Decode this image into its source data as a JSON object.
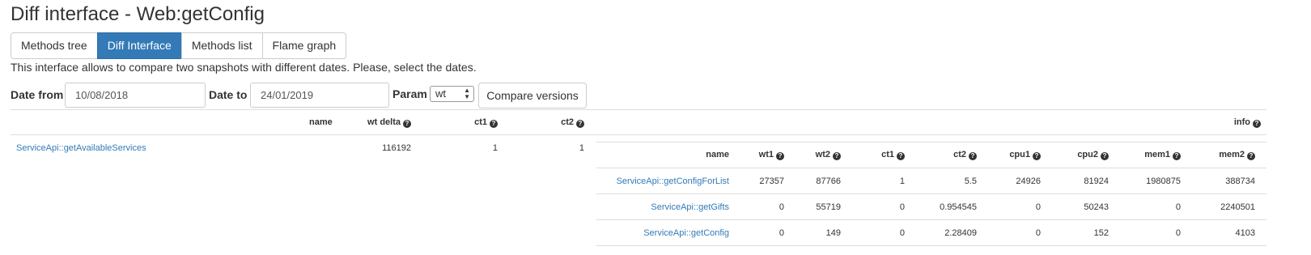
{
  "page": {
    "title": "Diff interface - Web:getConfig",
    "description": "This interface allows to compare two snapshots with different dates. Please, select the dates."
  },
  "tabs": [
    "Methods tree",
    "Diff Interface",
    "Methods list",
    "Flame graph"
  ],
  "active_tab": "Diff Interface",
  "form": {
    "date_from_label": "Date from",
    "date_from_value": "10/08/2018",
    "date_to_label": "Date to",
    "date_to_value": "24/01/2019",
    "param_label": "Param",
    "param_value": "wt",
    "compare_button": "Compare versions"
  },
  "left_table": {
    "columns": [
      "name",
      "wt delta",
      "ct1",
      "ct2"
    ],
    "rows": [
      {
        "name": "ServiceApi::getAvailableServices",
        "wt_delta": "116192",
        "ct1": "1",
        "ct2": "1"
      }
    ]
  },
  "info_label": "info",
  "right_table": {
    "columns": [
      "name",
      "wt1",
      "wt2",
      "ct1",
      "ct2",
      "cpu1",
      "cpu2",
      "mem1",
      "mem2"
    ],
    "rows": [
      {
        "name": "ServiceApi::getConfigForList",
        "wt1": "27357",
        "wt2": "87766",
        "ct1": "1",
        "ct2": "5.5",
        "cpu1": "24926",
        "cpu2": "81924",
        "mem1": "1980875",
        "mem2": "388734"
      },
      {
        "name": "ServiceApi::getGifts",
        "wt1": "0",
        "wt2": "55719",
        "ct1": "0",
        "ct2": "0.954545",
        "cpu1": "0",
        "cpu2": "50243",
        "mem1": "0",
        "mem2": "2240501"
      },
      {
        "name": "ServiceApi::getConfig",
        "wt1": "0",
        "wt2": "149",
        "ct1": "0",
        "ct2": "2.28409",
        "cpu1": "0",
        "cpu2": "152",
        "mem1": "0",
        "mem2": "4103"
      }
    ]
  },
  "icons": {
    "help": "question-circle-icon",
    "select_caret": "select-arrows-icon"
  },
  "colors": {
    "accent": "#337ab7",
    "link": "#337ab7"
  }
}
